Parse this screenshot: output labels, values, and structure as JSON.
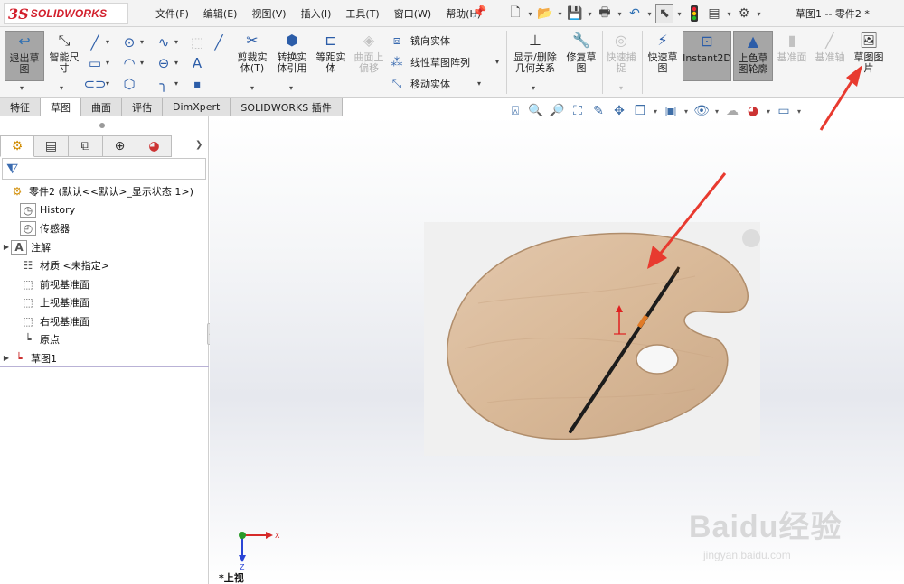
{
  "app": {
    "brand_mark": "3S",
    "brand_name": "SOLIDWORKS",
    "document_title": "草图1 -- 零件2 *"
  },
  "menu": [
    "文件(F)",
    "编辑(E)",
    "视图(V)",
    "插入(I)",
    "工具(T)",
    "窗口(W)",
    "帮助(H)"
  ],
  "quick_access": [
    "new-icon",
    "open-icon",
    "save-icon",
    "print-icon",
    "undo-icon",
    "select-icon",
    "rebuild-icon",
    "file-properties-icon",
    "options-icon"
  ],
  "ribbon": {
    "exit_sketch": "退出草图",
    "smart_dimension": "智能尺寸",
    "trim_entities": "剪裁实体(T)",
    "convert_entities": "转换实体引用",
    "offset_entities": "等距实体",
    "offset_on_surface": "曲面上偏移",
    "mirror_entities": "镜向实体",
    "linear_pattern": "线性草图阵列",
    "move_entities": "移动实体",
    "display_delete_relations": "显示/删除几何关系",
    "repair_sketch": "修复草图",
    "quick_snaps": "快速捕捉",
    "rapid_sketch": "快速草图",
    "instant2d": "Instant2D",
    "shaded_sketch_contours": "上色草图轮廓",
    "reference_plane": "基准面",
    "reference_axis": "基准轴",
    "sketch_picture": "草图图片"
  },
  "tabs": [
    "特征",
    "草图",
    "曲面",
    "评估",
    "DimXpert",
    "SOLIDWORKS 插件"
  ],
  "selected_tab": "草图",
  "feature_tree": {
    "root": "零件2 (默认<<默认>_显示状态 1>)",
    "items": [
      "History",
      "传感器",
      "注解",
      "材质 <未指定>",
      "前视基准面",
      "上视基准面",
      "右视基准面",
      "原点",
      "草图1"
    ]
  },
  "viewport": {
    "view_label": "*上视",
    "triad_x": "X",
    "triad_z": "Z"
  },
  "watermark": {
    "text": "Baidu经验",
    "url": "jingyan.baidu.com"
  },
  "colors": {
    "accent_red": "#e83a2f",
    "brand_red": "#d21e2b",
    "toolbar_bg": "#f5f5f5",
    "active_btn": "#a6a6a6"
  }
}
